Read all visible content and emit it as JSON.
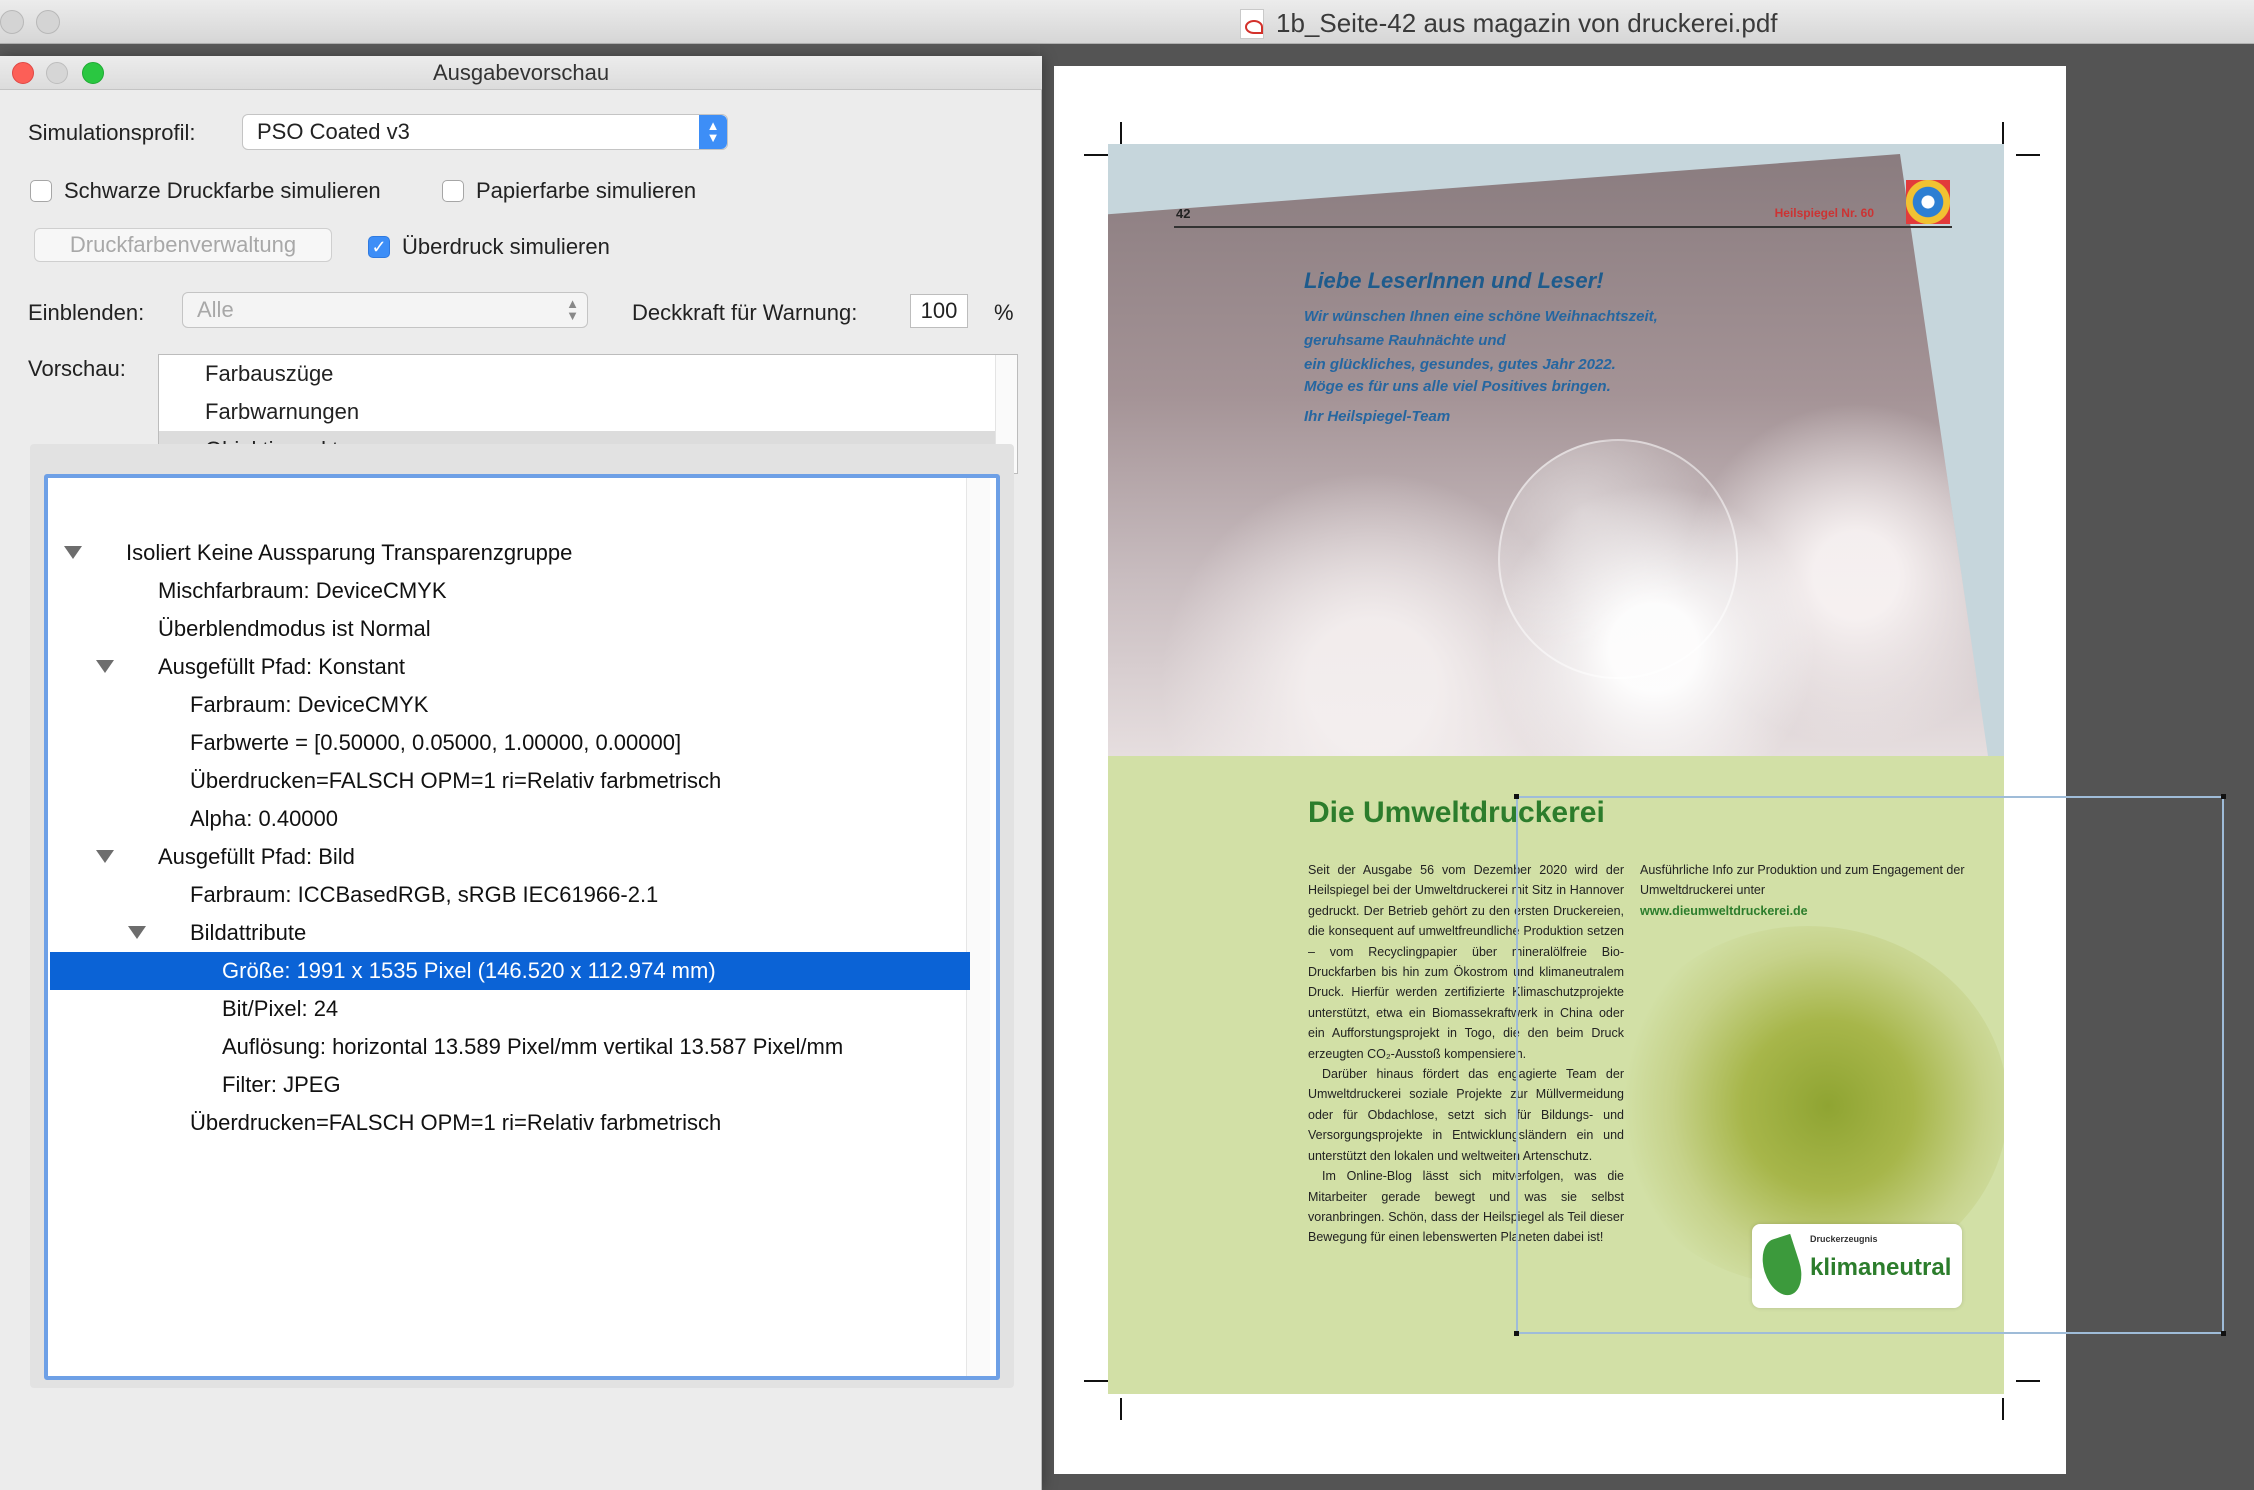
{
  "window": {
    "file_title": "1b_Seite-42 aus magazin von druckerei.pdf"
  },
  "dialog": {
    "title": "Ausgabevorschau",
    "simulation_profile_label": "Simulationsprofil:",
    "simulation_profile_value": "PSO Coated v3",
    "simulate_black_label": "Schwarze Druckfarbe simulieren",
    "simulate_black_checked": false,
    "simulate_paper_label": "Papierfarbe simulieren",
    "simulate_paper_checked": false,
    "ink_manager_button": "Druckfarbenverwaltung",
    "simulate_overprint_label": "Überdruck simulieren",
    "simulate_overprint_checked": true,
    "show_label": "Einblenden:",
    "show_value": "Alle",
    "warning_opacity_label": "Deckkraft für Warnung:",
    "warning_opacity_value": "100",
    "warning_opacity_unit": "%",
    "preview_label": "Vorschau:",
    "preview_options": [
      "Farbauszüge",
      "Farbwarnungen",
      "Objektinspektor"
    ],
    "preview_selected": "Objektinspektor"
  },
  "tree": [
    {
      "text": "Isoliert Keine Aussparung Transparenzgruppe",
      "level": 0,
      "expanded": true
    },
    {
      "text": "Mischfarbraum: DeviceCMYK",
      "level": 1
    },
    {
      "text": "Überblendmodus ist Normal",
      "level": 1
    },
    {
      "text": "Ausgefüllt Pfad: Konstant",
      "level": 1,
      "expanded": true
    },
    {
      "text": "Farbraum: DeviceCMYK",
      "level": 2
    },
    {
      "text": "Farbwerte = [0.50000, 0.05000, 1.00000, 0.00000]",
      "level": 2
    },
    {
      "text": "Überdrucken=FALSCH OPM=1 ri=Relativ farbmetrisch",
      "level": 2
    },
    {
      "text": "Alpha: 0.40000",
      "level": 2
    },
    {
      "text": "Ausgefüllt Pfad: Bild",
      "level": 1,
      "expanded": true
    },
    {
      "text": "Farbraum: ICCBasedRGB, sRGB IEC61966-2.1",
      "level": 2
    },
    {
      "text": "Bildattribute",
      "level": 2,
      "expanded": true
    },
    {
      "text": "Größe: 1991 x 1535 Pixel (146.520 x 112.974 mm)",
      "level": 3,
      "selected": true
    },
    {
      "text": "Bit/Pixel: 24",
      "level": 3
    },
    {
      "text": "Auflösung: horizontal 13.589 Pixel/mm vertikal 13.587 Pixel/mm",
      "level": 3
    },
    {
      "text": "Filter: JPEG",
      "level": 3
    },
    {
      "text": "Überdrucken=FALSCH OPM=1 ri=Relativ farbmetrisch",
      "level": 2
    }
  ],
  "pdf_page": {
    "page_number": "42",
    "magazine": "Heilspiegel Nr. 60",
    "greeting_head": "Liebe LeserInnen und Leser!",
    "greeting_lines": [
      "Wir wünschen Ihnen eine schöne Weihnachtszeit,",
      "geruhsame Rauhnächte und",
      "ein glückliches, gesundes, gutes Jahr 2022.",
      "Möge es für uns alle viel Positives bringen.",
      "Ihr Heilspiegel-Team"
    ],
    "article_title": "Die Umweltdruckerei",
    "article_paragraphs": [
      "Seit der Ausgabe 56 vom Dezember 2020 wird der Heilspiegel bei der Umweltdruckerei mit Sitz in Hannover gedruckt. Der Betrieb gehört zu den ersten Druckereien, die konsequent auf umweltfreundliche Produktion setzen – vom Recyclingpapier über mineralölfreie Bio-Druckfarben bis hin zum Ökostrom und klimaneutralem Druck. Hierfür werden zertifizierte Klimaschutzprojekte unterstützt, etwa ein Biomassekraftwerk in China oder ein Aufforstungsprojekt in Togo, die den beim Druck erzeugten CO₂-Ausstoß kompensieren.",
      "Darüber hinaus fördert das engagierte Team der Umweltdruckerei soziale Projekte zur Müllvermeidung oder für Obdachlose, setzt sich für Bildungs- und Versorgungsprojekte in Entwicklungsländern ein und unterstützt den lokalen und weltweiten Artenschutz.",
      "Im Online-Blog lässt sich mitverfolgen, was die Mitarbeiter gerade bewegt und was sie selbst voranbringen. Schön, dass der Heilspiegel als Teil dieser Bewegung für einen lebenswerten Planeten dabei ist!"
    ],
    "info_text": "Ausführliche Info zur Produktion und zum Engagement der Umweltdruckerei unter",
    "info_link": "www.dieumweltdruckerei.de",
    "badge_small": "Druckerzeugnis",
    "badge_big": "klimaneutral"
  },
  "colors": {
    "selection": "#0b63d6",
    "accent": "#3d8ef7",
    "article_green": "#2c7d2c"
  }
}
